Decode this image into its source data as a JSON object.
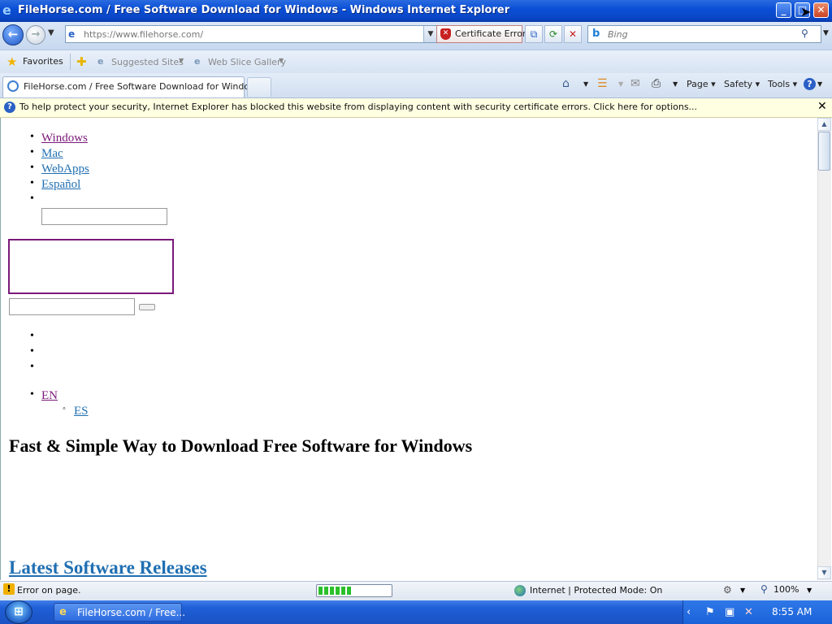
{
  "window": {
    "title": "FileHorse.com / Free Software Download for Windows - Windows Internet Explorer",
    "controls": [
      "minimize",
      "maximize",
      "close"
    ]
  },
  "navigation": {
    "address": "https://www.filehorse.com/",
    "security_status": "Certificate Error",
    "search_placeholder": "Bing"
  },
  "favorites_bar": {
    "favorites_label": "Favorites",
    "links": [
      "Suggested Sites",
      "Web Slice Gallery"
    ]
  },
  "tabs": [
    {
      "label": "FileHorse.com / Free Software Download for Windows"
    }
  ],
  "command_bar": {
    "page": "Page",
    "safety": "Safety",
    "tools": "Tools"
  },
  "info_bar": {
    "message": "To help protect your security, Internet Explorer has blocked this website from displaying content with security certificate errors. Click here for options..."
  },
  "content": {
    "nav_links": [
      "Windows",
      "Mac",
      "WebApps",
      "Español"
    ],
    "lang_links": [
      "EN",
      "ES"
    ],
    "main_heading": "Fast & Simple Way to Download Free Software for Windows",
    "latest_heading": "Latest Software Releases"
  },
  "status_bar": {
    "status_text": "Error on page.",
    "progress_fraction": 0.45,
    "zone": "Internet | Protected Mode: On",
    "zoom": "100%"
  },
  "taskbar": {
    "task_label": "FileHorse.com / Free...",
    "clock": "8:55 AM"
  },
  "colors": {
    "link_visited": "#7a1a7a",
    "link": "#1f6fb2",
    "title_bar": "#0b4fd6"
  }
}
